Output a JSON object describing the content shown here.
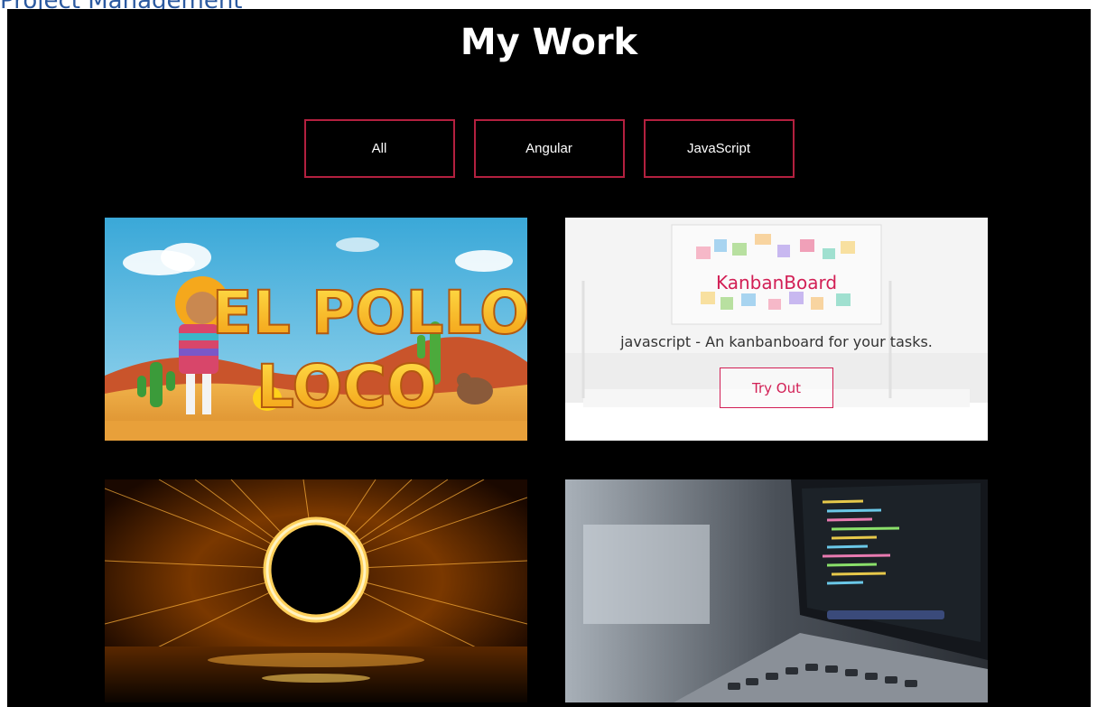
{
  "header": {
    "partial_heading": "Project Management"
  },
  "section": {
    "title": "My Work"
  },
  "filters": [
    {
      "label": "All"
    },
    {
      "label": "Angular"
    },
    {
      "label": "JavaScript"
    }
  ],
  "projects": [
    {
      "image_text_line1": "EL POLLO",
      "image_text_line2": "LOCO"
    },
    {
      "name": "KanbanBoard",
      "description": "javascript - An kanbanboard for your tasks.",
      "button_label": "Try Out"
    },
    {},
    {}
  ],
  "colors": {
    "background": "#000000",
    "accent": "#b3203f",
    "overlay_accent": "#d21f55",
    "heading_blue": "#2c5aa0"
  }
}
